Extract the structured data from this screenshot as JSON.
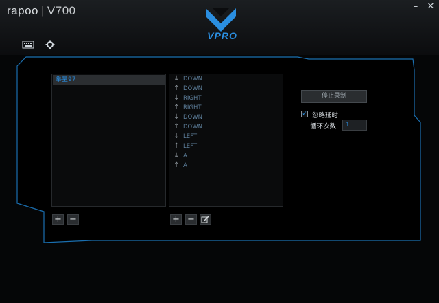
{
  "app": {
    "brand": "rapoo",
    "model": "V700",
    "logo_text": "VPRO",
    "min_label": "–",
    "close_label": "✕"
  },
  "toolbar": {
    "keyboard_icon": "keyboard-icon",
    "settings_icon": "gear-icon"
  },
  "macros": {
    "items": [
      {
        "label": "拳皇97"
      }
    ],
    "add_label": "+",
    "remove_label": "−"
  },
  "events": {
    "items": [
      {
        "dir": "↓",
        "key": "DOWN"
      },
      {
        "dir": "↑",
        "key": "DOWN"
      },
      {
        "dir": "↓",
        "key": "RIGHT"
      },
      {
        "dir": "↑",
        "key": "RIGHT"
      },
      {
        "dir": "↓",
        "key": "DOWN"
      },
      {
        "dir": "↑",
        "key": "DOWN"
      },
      {
        "dir": "↓",
        "key": "LEFT"
      },
      {
        "dir": "↑",
        "key": "LEFT"
      },
      {
        "dir": "↓",
        "key": "A"
      },
      {
        "dir": "↑",
        "key": "A"
      }
    ],
    "add_label": "+",
    "remove_label": "−",
    "edit_icon": "edit-icon"
  },
  "controls": {
    "stop_record_label": "停止录制",
    "ignore_delay_label": "忽略延时",
    "ignore_delay_checked": true,
    "loop_count_label": "循环次数",
    "loop_count_value": "1"
  },
  "colors": {
    "accent": "#2a8ee0",
    "background": "#050607",
    "panel_border": "#1a6fb0"
  }
}
